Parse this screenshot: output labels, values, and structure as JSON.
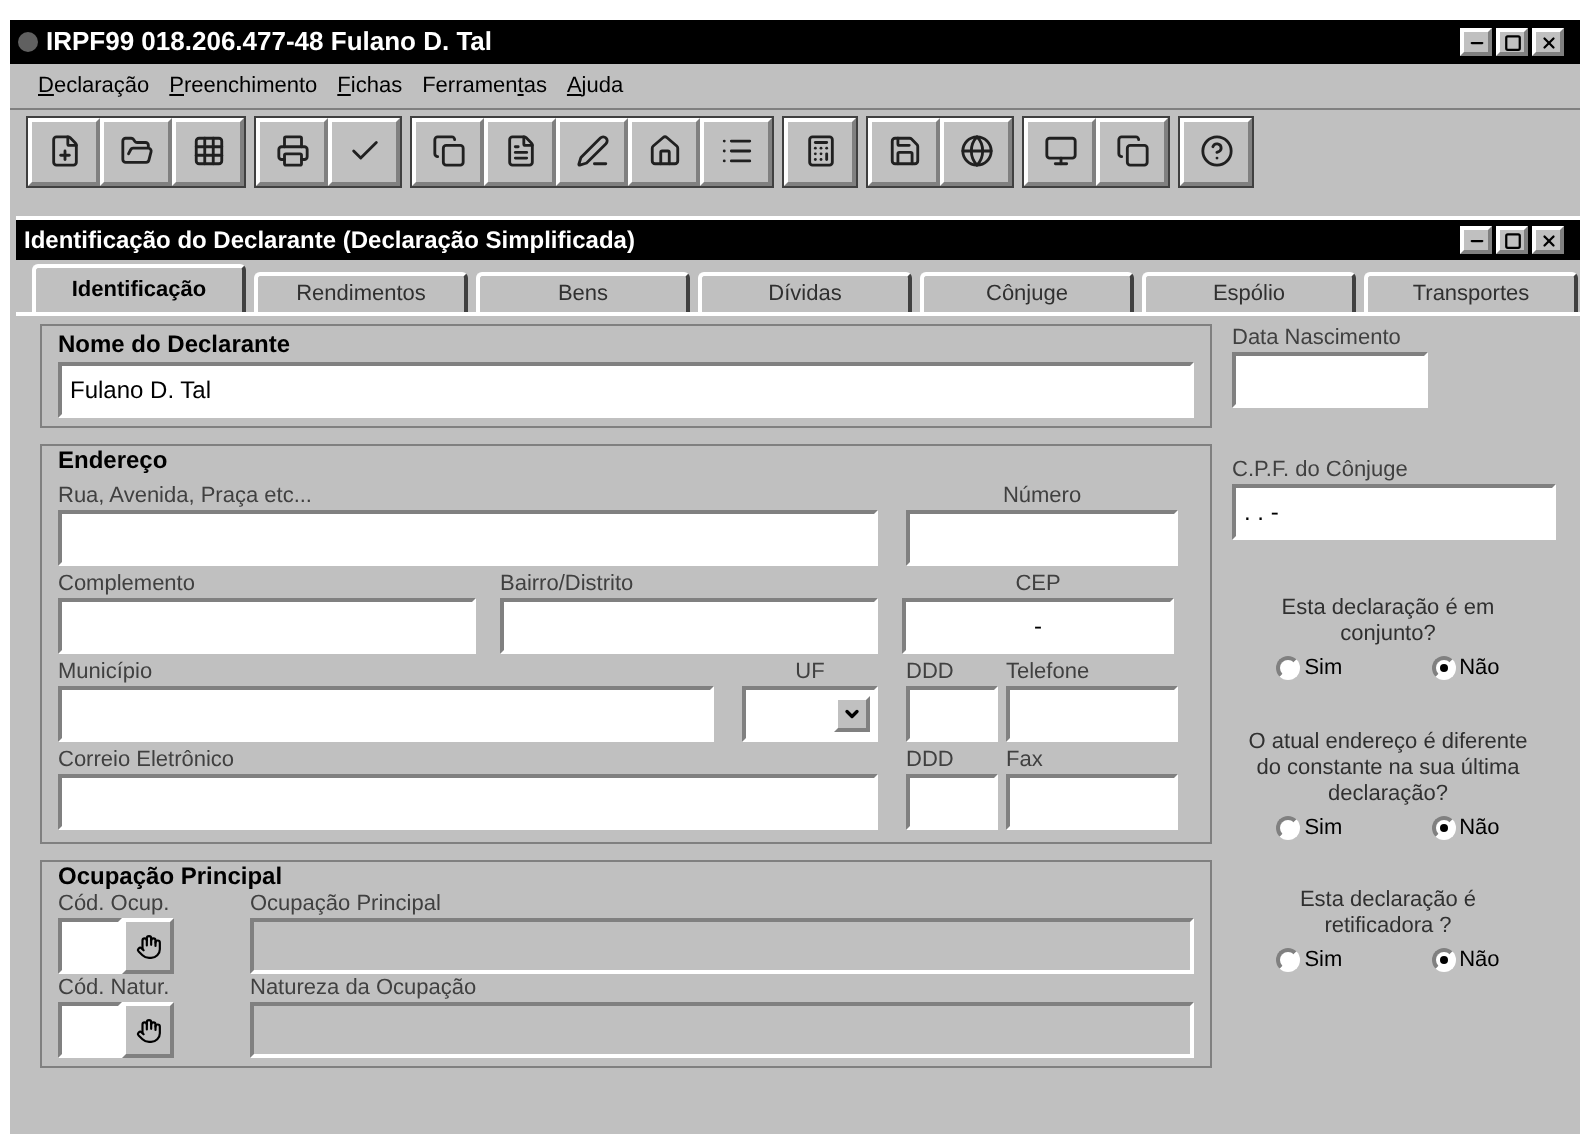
{
  "window": {
    "title": "IRPF99 018.206.477-48 Fulano D. Tal"
  },
  "menu": [
    {
      "key": "D",
      "post": "eclaração"
    },
    {
      "key": "P",
      "post": "reenchimento"
    },
    {
      "key": "F",
      "post": "ichas"
    },
    {
      "pre": "Ferramen",
      "key": "t",
      "post": "as"
    },
    {
      "key": "A",
      "post": "juda"
    }
  ],
  "toolbar": [
    [
      {
        "kind": "new"
      },
      {
        "kind": "open"
      },
      {
        "kind": "grid"
      }
    ],
    [
      {
        "kind": "print"
      },
      {
        "kind": "check"
      }
    ],
    [
      {
        "kind": "copy"
      },
      {
        "kind": "form"
      },
      {
        "kind": "pen"
      },
      {
        "kind": "home"
      },
      {
        "kind": "list"
      }
    ],
    [
      {
        "kind": "calc"
      }
    ],
    [
      {
        "kind": "save"
      },
      {
        "kind": "globe"
      }
    ],
    [
      {
        "kind": "screen"
      },
      {
        "kind": "copy"
      }
    ],
    [
      {
        "kind": "help"
      }
    ]
  ],
  "form": {
    "title": "Identificação do Declarante (Declaração Simplificada)",
    "tabs": [
      {
        "label": "Identificação",
        "selected": true
      },
      {
        "label": "Rendimentos",
        "selected": false
      },
      {
        "label": "Bens",
        "selected": false
      },
      {
        "label": "Dívidas",
        "selected": false
      },
      {
        "label": "Cônjuge",
        "selected": false
      },
      {
        "label": "Espólio",
        "selected": false
      },
      {
        "label": "Transportes",
        "selected": false
      }
    ],
    "nome": {
      "heading": "Nome do Declarante",
      "value": "Fulano D. Tal"
    },
    "endereco": {
      "heading": "Endereço",
      "rua": {
        "label": "Rua, Avenida, Praça etc..."
      },
      "numero": {
        "label": "Número"
      },
      "complemento": {
        "label": "Complemento"
      },
      "bairro": {
        "label": "Bairro/Distrito"
      },
      "cep": {
        "label": "CEP",
        "value": "-"
      },
      "municipio": {
        "label": "Município"
      },
      "uf": {
        "label": "UF"
      },
      "ddd_telefone": {
        "label": "DDD"
      },
      "telefone": {
        "label": "Telefone"
      },
      "email": {
        "label": "Correio Eletrônico"
      },
      "ddd_fax": {
        "label": "DDD"
      },
      "fax": {
        "label": "Fax"
      }
    },
    "ocupacao": {
      "heading": "Ocupação Principal",
      "rows": [
        {
          "code_label": "Cód. Ocup.",
          "name_label": "Ocupação Principal"
        },
        {
          "code_label": "Cód. Natur.",
          "name_label": "Natureza da Ocupação"
        }
      ]
    },
    "data_nascimento": {
      "label": "Data Nascimento"
    },
    "cpf_conjuge": {
      "label": "C.P.F. do Cônjuge",
      "value": ". . -"
    },
    "questions": [
      {
        "question": "Esta declaração é em conjunto?",
        "options": [
          {
            "label": "Sim",
            "selected": false
          },
          {
            "label": "Não",
            "selected": true
          }
        ]
      },
      {
        "question": "O atual endereço é diferente do constante na sua última declaração?",
        "options": [
          {
            "label": "Sim",
            "selected": false
          },
          {
            "label": "Não",
            "selected": true
          }
        ]
      },
      {
        "question": "Esta declaração é retificadora ?",
        "options": [
          {
            "label": "Sim",
            "selected": false
          },
          {
            "label": "Não",
            "selected": true
          }
        ]
      }
    ]
  }
}
